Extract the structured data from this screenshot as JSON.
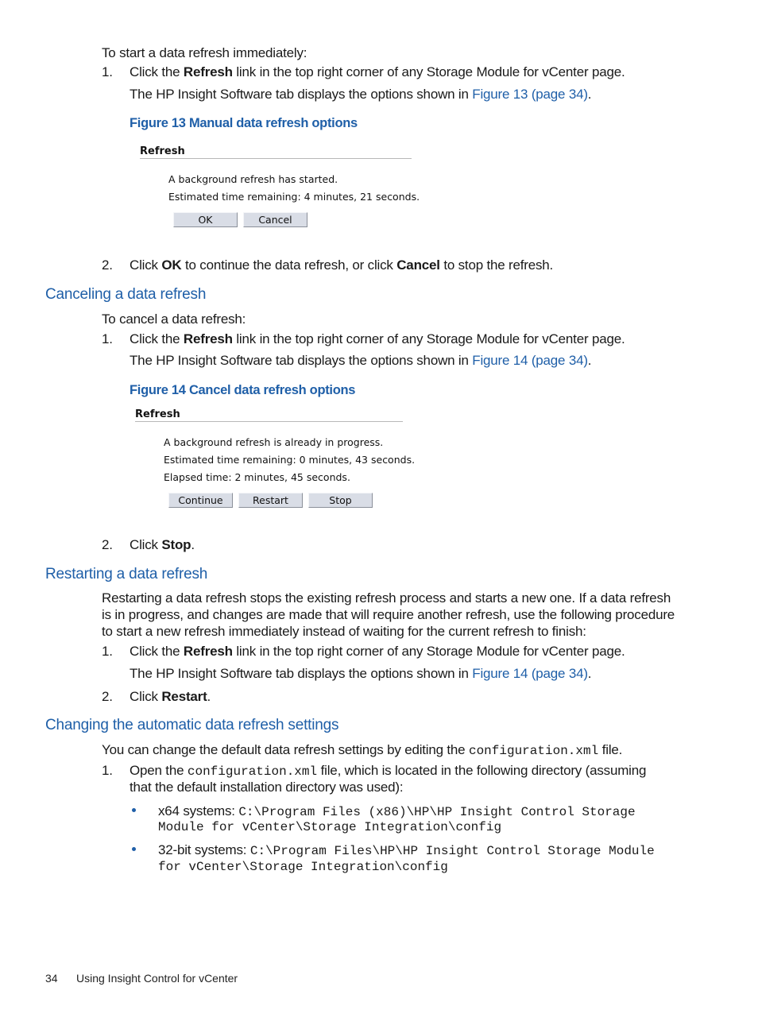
{
  "colors": {
    "heading": "#1f5fa8",
    "link": "#1f5fa8",
    "button_bg": "#d9dde6"
  },
  "intro": {
    "text": "To start a data refresh immediately:",
    "step1": {
      "num": "1.",
      "pre": "Click the ",
      "bold": "Refresh",
      "post": " link in the top right corner of any Storage Module for vCenter page."
    },
    "step1_note": {
      "pre": "The HP Insight Software tab displays the options shown in ",
      "link": "Figure 13 (page 34)",
      "post": "."
    },
    "figure_caption": "Figure 13 Manual data refresh options",
    "step2": {
      "num": "2.",
      "pre": "Click ",
      "bold1": "OK",
      "mid": " to continue the data refresh, or click ",
      "bold2": "Cancel",
      "post": " to stop the refresh."
    }
  },
  "figure13": {
    "title": "Refresh",
    "lines": [
      "A background refresh has started.",
      "Estimated time remaining: 4 minutes, 21 seconds."
    ],
    "buttons": [
      "OK",
      "Cancel"
    ]
  },
  "canceling": {
    "heading": "Canceling a data refresh",
    "text": "To cancel a data refresh:",
    "step1": {
      "num": "1.",
      "pre": "Click the ",
      "bold": "Refresh",
      "post": " link in the top right corner of any Storage Module for vCenter page."
    },
    "step1_note": {
      "pre": "The HP Insight Software tab displays the options shown in ",
      "link": "Figure 14 (page 34)",
      "post": "."
    },
    "figure_caption": "Figure 14 Cancel data refresh options",
    "step2": {
      "num": "2.",
      "pre": "Click ",
      "bold": "Stop",
      "post": "."
    }
  },
  "figure14": {
    "title": "Refresh",
    "lines": [
      "A background refresh is already in progress.",
      "Estimated time remaining: 0 minutes, 43 seconds.",
      "Elapsed time: 2 minutes, 45 seconds."
    ],
    "buttons": [
      "Continue",
      "Restart",
      "Stop"
    ]
  },
  "restarting": {
    "heading": "Restarting a data refresh",
    "para_lines": [
      "Restarting a data refresh stops the existing refresh process and starts a new one. If a data refresh",
      "is in progress, and changes are made that will require another refresh, use the following procedure",
      "to start a new refresh immediately instead of waiting for the current refresh to finish:"
    ],
    "step1": {
      "num": "1.",
      "pre": "Click the ",
      "bold": "Refresh",
      "post": " link in the top right corner of any Storage Module for vCenter page."
    },
    "step1_note": {
      "pre": "The HP Insight Software tab displays the options shown in ",
      "link": "Figure 14 (page 34)",
      "post": "."
    },
    "step2": {
      "num": "2.",
      "pre": "Click ",
      "bold": "Restart",
      "post": "."
    }
  },
  "changing": {
    "heading": "Changing the automatic data refresh settings",
    "para": {
      "pre": "You can change the default data refresh settings by editing the ",
      "code": "configuration.xml",
      "post": " file."
    },
    "step1": {
      "num": "1.",
      "pre": "Open the ",
      "code": "configuration.xml",
      "post": " file, which is located in the following directory (assuming",
      "line2": "that the default installation directory was used):"
    },
    "bullets": [
      {
        "label": "x64 systems: ",
        "code_line1": "C:\\Program Files (x86)\\HP\\HP Insight Control Storage",
        "code_line2": "Module for vCenter\\Storage Integration\\config"
      },
      {
        "label": "32-bit systems: ",
        "code_line1": "C:\\Program Files\\HP\\HP Insight Control Storage Module",
        "code_line2": "for vCenter\\Storage Integration\\config"
      }
    ]
  },
  "footer": {
    "page_number": "34",
    "title": "Using Insight Control for vCenter"
  }
}
